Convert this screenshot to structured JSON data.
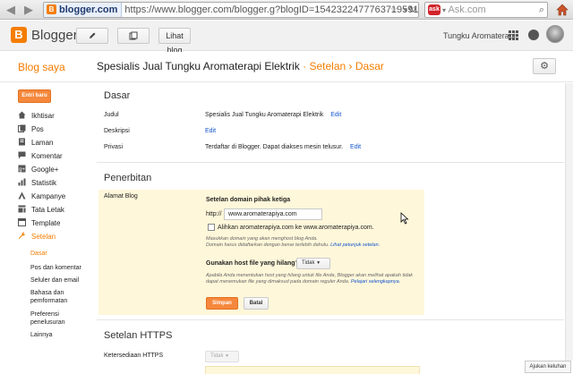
{
  "browser": {
    "site_badge": "blogger.com",
    "url": "https://www.blogger.com/blogger.g?blogID=1542322477763719591#",
    "search_placeholder": "Ask.com"
  },
  "topbar": {
    "app_name": "Blogger",
    "lihat_blog": "Lihat blog",
    "user_name": "Tungku Aromaterapi"
  },
  "header": {
    "blog_saya": "Blog saya",
    "blog_title": "Spesialis Jual Tungku Aromaterapi Elektrik",
    "sep1": "·",
    "crumb_setelan": "Setelan",
    "sep2": "›",
    "crumb_dasar": "Dasar"
  },
  "sidebar": {
    "new_post": "Entri baru",
    "items": [
      {
        "label": "Ikhtisar",
        "icon": "home-icon"
      },
      {
        "label": "Pos",
        "icon": "posts-icon"
      },
      {
        "label": "Laman",
        "icon": "pages-icon"
      },
      {
        "label": "Komentar",
        "icon": "comments-icon"
      },
      {
        "label": "Google+",
        "icon": "google-plus-icon"
      },
      {
        "label": "Statistik",
        "icon": "stats-icon"
      },
      {
        "label": "Kampanye",
        "icon": "adwords-icon"
      },
      {
        "label": "Tata Letak",
        "icon": "layout-icon"
      },
      {
        "label": "Template",
        "icon": "template-icon"
      },
      {
        "label": "Setelan",
        "icon": "wrench-icon"
      }
    ],
    "sub_items": [
      "Dasar",
      "Pos dan komentar",
      "Seluler dan email",
      "Bahasa dan pemformatan",
      "Preferensi penelusuran",
      "Lainnya"
    ]
  },
  "main": {
    "section_basic": "Dasar",
    "judul_label": "Judul",
    "judul_value": "Spesialis Jual Tungku Aromaterapi Elektrik",
    "deskripsi_label": "Deskripsi",
    "privasi_label": "Privasi",
    "privasi_value": "Terdaftar di Blogger. Dapat diakses mesin telusur.",
    "edit": "Edit",
    "section_publish": "Penerbitan",
    "alamat_label": "Alamat Blog",
    "custom_domain_title": "Setelan domain pihak ketiga",
    "http_prefix": "http://",
    "domain_value": "www.aromaterapiya.com",
    "redirect_label": "Alihkan aromaterapiya.com ke www.aromaterapiya.com.",
    "help1": "Masukkan domain yang akan menghost blog Anda.",
    "help2_prefix": "Domain harus didaftarkan dengan benar terlebih dahulu. ",
    "help2_link": "Lihat petunjuk setelan.",
    "missing_host_q": "Gunakan host file yang hilang?",
    "missing_host_value": "Tidak",
    "help3": "Apabila Anda menentukan host yang hilang untuk file Anda, Blogger akan melihat apakah tidak dapat menemukan file yang dimaksud pada domain reguler Anda. ",
    "help3_link": "Pelajari selengkapnya.",
    "save": "Simpan",
    "cancel": "Batal",
    "section_https": "Setelan HTTPS",
    "https_label": "Ketersediaan HTTPS",
    "https_value": "Tidak"
  },
  "feedback": "Ajukan keluhan",
  "colors": {
    "accent": "#f57d00",
    "link": "#1155cc",
    "panel": "#fff7da"
  }
}
